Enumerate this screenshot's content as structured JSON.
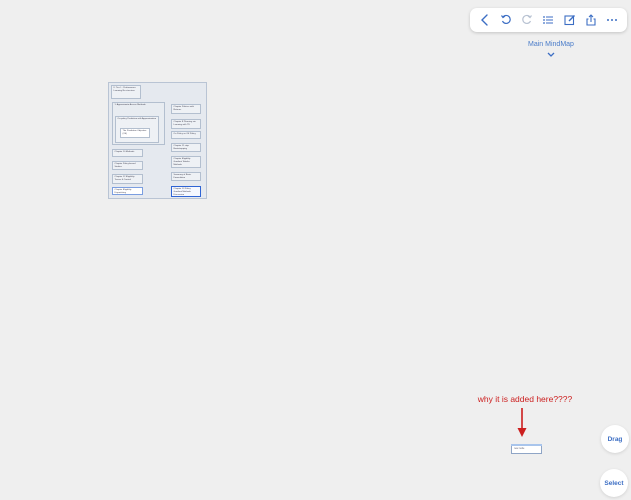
{
  "toolbar": {
    "icons": [
      "back-chevron-icon",
      "undo-icon",
      "redo-icon",
      "outline-list-icon",
      "edit-icon",
      "share-icon",
      "more-icon"
    ]
  },
  "header": {
    "map_title": "Main MindMap"
  },
  "mindmap": {
    "root": "II. Tier I – Performance Learning Re-structure",
    "left_nodes": [
      "1. Approximate Access Methods",
      "On-policy Prediction with Approximation",
      "The Prediction Objective (VE)",
      "Chapter 10 Methods",
      "Chapter Policy-based Studies",
      "Chapter 12 Eligibility Traces & Control",
      "Chapter Eligibility Dispatching"
    ],
    "right_nodes": [
      "Chapter Policies with Returns",
      "Chapter 8 Planning via Learning with TD",
      "On Policy as Off Policy",
      "Chapter 11 step Bootstrapping",
      "Chapter Eligibility Gradient Tabular Methods",
      "Summary of Basic Formulation",
      "Chapter 13 Policy Gradient Methods Discussion"
    ]
  },
  "annotation": {
    "text": "why it is added here????"
  },
  "stray_node": {
    "text": "new node"
  },
  "buttons": {
    "drag": "Drag",
    "select": "Select"
  },
  "colors": {
    "accent": "#3c6ec4",
    "annotation": "#cc1f1f",
    "selection": "#2f64d4"
  }
}
